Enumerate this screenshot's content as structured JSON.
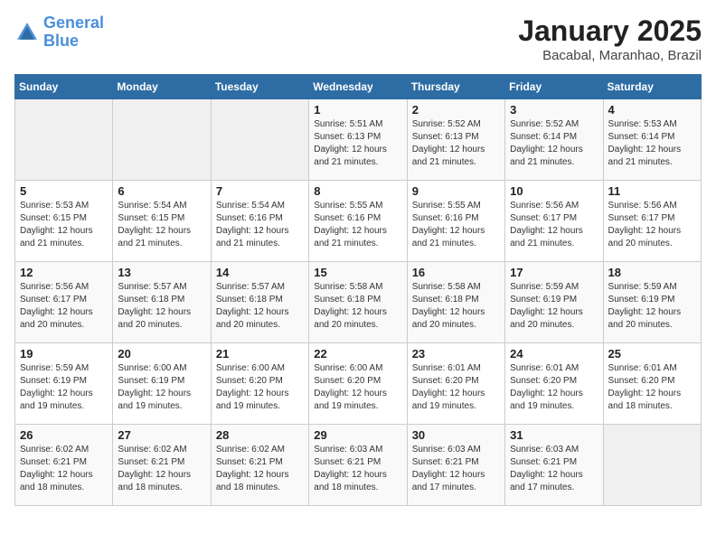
{
  "header": {
    "logo_line1": "General",
    "logo_line2": "Blue",
    "month": "January 2025",
    "location": "Bacabal, Maranhao, Brazil"
  },
  "weekdays": [
    "Sunday",
    "Monday",
    "Tuesday",
    "Wednesday",
    "Thursday",
    "Friday",
    "Saturday"
  ],
  "weeks": [
    [
      {
        "day": "",
        "info": ""
      },
      {
        "day": "",
        "info": ""
      },
      {
        "day": "",
        "info": ""
      },
      {
        "day": "1",
        "info": "Sunrise: 5:51 AM\nSunset: 6:13 PM\nDaylight: 12 hours and 21 minutes."
      },
      {
        "day": "2",
        "info": "Sunrise: 5:52 AM\nSunset: 6:13 PM\nDaylight: 12 hours and 21 minutes."
      },
      {
        "day": "3",
        "info": "Sunrise: 5:52 AM\nSunset: 6:14 PM\nDaylight: 12 hours and 21 minutes."
      },
      {
        "day": "4",
        "info": "Sunrise: 5:53 AM\nSunset: 6:14 PM\nDaylight: 12 hours and 21 minutes."
      }
    ],
    [
      {
        "day": "5",
        "info": "Sunrise: 5:53 AM\nSunset: 6:15 PM\nDaylight: 12 hours and 21 minutes."
      },
      {
        "day": "6",
        "info": "Sunrise: 5:54 AM\nSunset: 6:15 PM\nDaylight: 12 hours and 21 minutes."
      },
      {
        "day": "7",
        "info": "Sunrise: 5:54 AM\nSunset: 6:16 PM\nDaylight: 12 hours and 21 minutes."
      },
      {
        "day": "8",
        "info": "Sunrise: 5:55 AM\nSunset: 6:16 PM\nDaylight: 12 hours and 21 minutes."
      },
      {
        "day": "9",
        "info": "Sunrise: 5:55 AM\nSunset: 6:16 PM\nDaylight: 12 hours and 21 minutes."
      },
      {
        "day": "10",
        "info": "Sunrise: 5:56 AM\nSunset: 6:17 PM\nDaylight: 12 hours and 21 minutes."
      },
      {
        "day": "11",
        "info": "Sunrise: 5:56 AM\nSunset: 6:17 PM\nDaylight: 12 hours and 20 minutes."
      }
    ],
    [
      {
        "day": "12",
        "info": "Sunrise: 5:56 AM\nSunset: 6:17 PM\nDaylight: 12 hours and 20 minutes."
      },
      {
        "day": "13",
        "info": "Sunrise: 5:57 AM\nSunset: 6:18 PM\nDaylight: 12 hours and 20 minutes."
      },
      {
        "day": "14",
        "info": "Sunrise: 5:57 AM\nSunset: 6:18 PM\nDaylight: 12 hours and 20 minutes."
      },
      {
        "day": "15",
        "info": "Sunrise: 5:58 AM\nSunset: 6:18 PM\nDaylight: 12 hours and 20 minutes."
      },
      {
        "day": "16",
        "info": "Sunrise: 5:58 AM\nSunset: 6:18 PM\nDaylight: 12 hours and 20 minutes."
      },
      {
        "day": "17",
        "info": "Sunrise: 5:59 AM\nSunset: 6:19 PM\nDaylight: 12 hours and 20 minutes."
      },
      {
        "day": "18",
        "info": "Sunrise: 5:59 AM\nSunset: 6:19 PM\nDaylight: 12 hours and 20 minutes."
      }
    ],
    [
      {
        "day": "19",
        "info": "Sunrise: 5:59 AM\nSunset: 6:19 PM\nDaylight: 12 hours and 19 minutes."
      },
      {
        "day": "20",
        "info": "Sunrise: 6:00 AM\nSunset: 6:19 PM\nDaylight: 12 hours and 19 minutes."
      },
      {
        "day": "21",
        "info": "Sunrise: 6:00 AM\nSunset: 6:20 PM\nDaylight: 12 hours and 19 minutes."
      },
      {
        "day": "22",
        "info": "Sunrise: 6:00 AM\nSunset: 6:20 PM\nDaylight: 12 hours and 19 minutes."
      },
      {
        "day": "23",
        "info": "Sunrise: 6:01 AM\nSunset: 6:20 PM\nDaylight: 12 hours and 19 minutes."
      },
      {
        "day": "24",
        "info": "Sunrise: 6:01 AM\nSunset: 6:20 PM\nDaylight: 12 hours and 19 minutes."
      },
      {
        "day": "25",
        "info": "Sunrise: 6:01 AM\nSunset: 6:20 PM\nDaylight: 12 hours and 18 minutes."
      }
    ],
    [
      {
        "day": "26",
        "info": "Sunrise: 6:02 AM\nSunset: 6:21 PM\nDaylight: 12 hours and 18 minutes."
      },
      {
        "day": "27",
        "info": "Sunrise: 6:02 AM\nSunset: 6:21 PM\nDaylight: 12 hours and 18 minutes."
      },
      {
        "day": "28",
        "info": "Sunrise: 6:02 AM\nSunset: 6:21 PM\nDaylight: 12 hours and 18 minutes."
      },
      {
        "day": "29",
        "info": "Sunrise: 6:03 AM\nSunset: 6:21 PM\nDaylight: 12 hours and 18 minutes."
      },
      {
        "day": "30",
        "info": "Sunrise: 6:03 AM\nSunset: 6:21 PM\nDaylight: 12 hours and 17 minutes."
      },
      {
        "day": "31",
        "info": "Sunrise: 6:03 AM\nSunset: 6:21 PM\nDaylight: 12 hours and 17 minutes."
      },
      {
        "day": "",
        "info": ""
      }
    ]
  ]
}
